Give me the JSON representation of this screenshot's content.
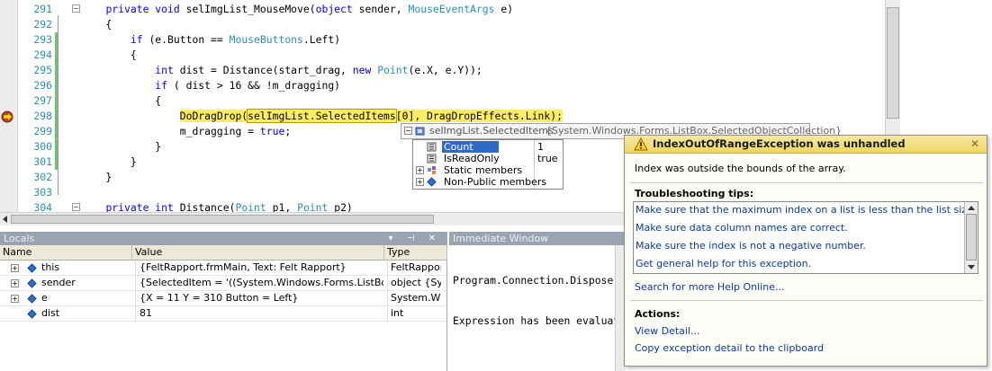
{
  "editor": {
    "lines": [
      {
        "num": "291",
        "segments": [
          {
            "t": "    "
          },
          {
            "t": "private void ",
            "c": "kw"
          },
          {
            "t": "selImgList_MouseMove("
          },
          {
            "t": "object ",
            "c": "kw"
          },
          {
            "t": "sender, "
          },
          {
            "t": "MouseEventArgs",
            "c": "ty"
          },
          {
            "t": " e)"
          }
        ]
      },
      {
        "num": "292",
        "segments": [
          {
            "t": "    {"
          }
        ]
      },
      {
        "num": "293",
        "segments": [
          {
            "t": "        "
          },
          {
            "t": "if ",
            "c": "kw"
          },
          {
            "t": "(e.Button == "
          },
          {
            "t": "MouseButtons",
            "c": "ty"
          },
          {
            "t": ".Left)"
          }
        ]
      },
      {
        "num": "294",
        "segments": [
          {
            "t": "        {"
          }
        ]
      },
      {
        "num": "295",
        "segments": [
          {
            "t": "            "
          },
          {
            "t": "int ",
            "c": "kw"
          },
          {
            "t": "dist = Distance(start_drag, "
          },
          {
            "t": "new ",
            "c": "kw"
          },
          {
            "t": "Point",
            "c": "ty"
          },
          {
            "t": "(e.X, e.Y));"
          }
        ]
      },
      {
        "num": "296",
        "segments": [
          {
            "t": "            "
          },
          {
            "t": "if ",
            "c": "kw"
          },
          {
            "t": "( dist > 16 && !m_dragging)"
          }
        ]
      },
      {
        "num": "297",
        "segments": [
          {
            "t": "            {"
          }
        ]
      },
      {
        "num": "298",
        "segments": [
          {
            "t": "                "
          },
          {
            "t": "DoDragDrop(",
            "c": "hl"
          },
          {
            "t": "selImgList.SelectedItems",
            "c": "hl-box"
          },
          {
            "t": "[0], DragDropEffects.Link);",
            "c": "hl"
          }
        ]
      },
      {
        "num": "299",
        "segments": [
          {
            "t": "                m_dragging = "
          },
          {
            "t": "true",
            "c": "kw"
          },
          {
            "t": ";"
          }
        ]
      },
      {
        "num": "300",
        "segments": [
          {
            "t": "            }"
          }
        ]
      },
      {
        "num": "301",
        "segments": [
          {
            "t": "        }"
          }
        ]
      },
      {
        "num": "302",
        "segments": [
          {
            "t": "    }"
          }
        ]
      },
      {
        "num": "303",
        "segments": [
          {
            "t": ""
          }
        ]
      },
      {
        "num": "304",
        "segments": [
          {
            "t": "    "
          },
          {
            "t": "private int ",
            "c": "kw"
          },
          {
            "t": "Distance("
          },
          {
            "t": "Point",
            "c": "ty"
          },
          {
            "t": " p1, "
          },
          {
            "t": "Point",
            "c": "ty"
          },
          {
            "t": " p2)"
          }
        ]
      }
    ]
  },
  "datatip": {
    "expression": "selImgList.SelectedItems",
    "value": "{System.Windows.Forms.ListBox.SelectedObjectCollection}",
    "members": [
      {
        "name": "Count",
        "value": "1",
        "selected": true,
        "expandable": false,
        "icon": "property-icon"
      },
      {
        "name": "IsReadOnly",
        "value": "true",
        "selected": false,
        "expandable": false,
        "icon": "property-icon"
      },
      {
        "name": "Static members",
        "value": "",
        "selected": false,
        "expandable": true,
        "icon": "static-members-icon"
      },
      {
        "name": "Non-Public members",
        "value": "",
        "selected": false,
        "expandable": true,
        "icon": "field-icon"
      }
    ]
  },
  "locals": {
    "title": "Locals",
    "controls": "▾ ⊣ ✕",
    "columns": [
      "Name",
      "Value",
      "Type"
    ],
    "rows": [
      {
        "name": "this",
        "value": "{FeltRapport.frmMain, Text: Felt Rapport}",
        "type": "FeltRapport.frmMain",
        "expandable": true
      },
      {
        "name": "sender",
        "value": "{SelectedItem = '((System.Windows.Forms.ListBox)((System.Windows.Forms.ListBox)(sender))).SelectedItem' threw an exception}",
        "type": "object {System.Windows.Forms.ListBox}",
        "expandable": true
      },
      {
        "name": "e",
        "value": "{X = 11 Y = 310 Button = Left}",
        "type": "System.Windows.Forms.MouseEventArgs",
        "expandable": true
      },
      {
        "name": "dist",
        "value": "81",
        "type": "int",
        "expandable": false
      }
    ]
  },
  "immediate": {
    "title": "Immediate Window",
    "lines": [
      "Program.Connection.Dispose()",
      "Expression has been evaluated and has no value"
    ]
  },
  "exception": {
    "title": "IndexOutOfRangeException was unhandled",
    "message": "Index was outside the bounds of the array.",
    "tips_header": "Troubleshooting tips:",
    "tips": [
      "Make sure that the maximum index on a list is less than the list size.",
      "Make sure data column names are correct.",
      "Make sure the index is not a negative number.",
      "Get general help for this exception."
    ],
    "search_link": "Search for more Help Online...",
    "actions_header": "Actions:",
    "actions": [
      "View Detail...",
      "Copy exception detail to the clipboard"
    ],
    "close_glyph": "✕"
  },
  "colors": {
    "keyword": "#0000ff",
    "type": "#2b91af",
    "highlight": "#ffee62",
    "link": "#0a3aa6",
    "header_gold": "#eed566"
  }
}
